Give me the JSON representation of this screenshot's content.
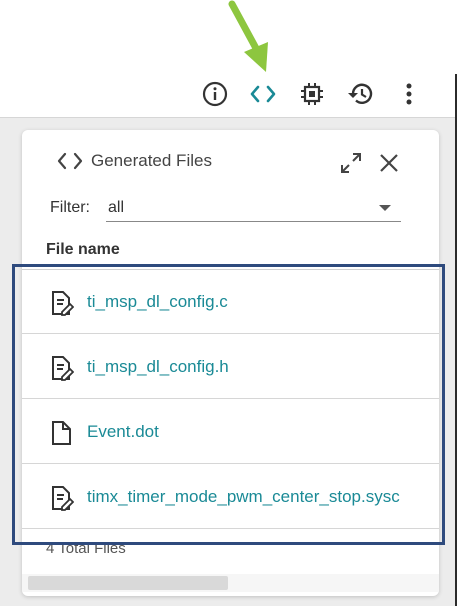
{
  "toolbar": {
    "icons": [
      "info-icon",
      "code-icon",
      "chip-icon",
      "history-icon",
      "more-vertical-icon"
    ],
    "active_color": "#1a8a96"
  },
  "panel": {
    "title": "Generated Files",
    "filter_label": "Filter:",
    "filter_value": "all",
    "column_header": "File name",
    "files": [
      {
        "name": "ti_msp_dl_config.c",
        "icon": "code-file-icon"
      },
      {
        "name": "ti_msp_dl_config.h",
        "icon": "code-file-icon"
      },
      {
        "name": "Event.dot",
        "icon": "file-icon"
      },
      {
        "name": "timx_timer_mode_pwm_center_stop.sysc",
        "icon": "code-file-icon"
      }
    ],
    "total": "4 Total Files"
  },
  "annotations": {
    "arrow_color": "#8dc63f",
    "highlight_color": "#2e4a7d"
  }
}
